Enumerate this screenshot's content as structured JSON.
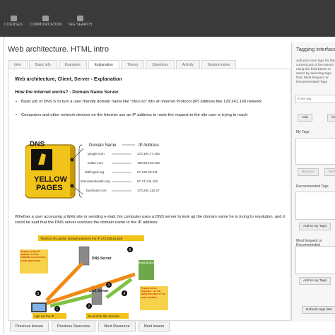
{
  "topnav": [
    {
      "label": "COURSES"
    },
    {
      "label": "COMMUNICATION"
    },
    {
      "label": "TAG SEARCH"
    }
  ],
  "page_title": "Web architecture. HTML intro",
  "tabs": [
    {
      "label": "Intro"
    },
    {
      "label": "Basic info"
    },
    {
      "label": "Examples"
    },
    {
      "label": "Explanation",
      "active": true
    },
    {
      "label": "Theory"
    },
    {
      "label": "Questions"
    },
    {
      "label": "Activity"
    },
    {
      "label": "Session notes"
    }
  ],
  "content": {
    "heading": "Web architecture, Client, Server - Explanation",
    "subheading": "How the Internet works? - Domain Name Server",
    "bullets": [
      "Basic job of DNS is to turn a user friendly domain name like \"ntnu.no\" into an Internet Protocol (IP) address like 129.241.160 network",
      "Computers and other network devices on the Internet use an IP address to route the request to the site user is trying to reach"
    ],
    "dns": {
      "logo_title": "DNS",
      "logo_line1": "YELLOW",
      "logo_line2": "PAGES",
      "col_domain": "Domain Name",
      "col_ip": "IP Address",
      "rows": [
        {
          "domain": "google.com",
          "ip": "173.194.77.184"
        },
        {
          "domain": "twitter.com",
          "ip": "199.59.149.230"
        },
        {
          "domain": "allthingsd.org",
          "ip": "67.132.20.211"
        },
        {
          "domain": "ibmnetworkradio.org",
          "ip": "97.74.144.182"
        },
        {
          "domain": "facebook.com",
          "ip": "173.252.110.27"
        }
      ]
    },
    "paragraph": "Whether a user accessing a Web site or sending e-mail, his computer uses a DNS server to look up the domain name he is trying to resolution, and it could be said that the DNS server resolves the domain name to the IP address.",
    "diagram": {
      "banner": "That's in my cache. Domain points to the IP 173.245.61.526",
      "server_top": "DNS Server",
      "server_bottom": "DNS Server",
      "site": "www.gohacking.com",
      "note_left": "Thanks for the IP address. Let me establish a connection to the server now.",
      "note_right": "Thanks for the response. Let me cache the same IP for some duration",
      "bottom_left": "I get me the IP",
      "bottom_mid": "Record for this Domain",
      "nums": [
        "1",
        "2",
        "3",
        "4",
        "5",
        "6"
      ]
    }
  },
  "pager": [
    {
      "label": "Previous lesson"
    },
    {
      "label": "Previous Resource"
    },
    {
      "label": "Next Resource"
    },
    {
      "label": "Next lesson"
    }
  ],
  "panel": {
    "title": "Tagging interface",
    "description": "Add your own tags for the current part of the lesson using the field below or select by selecting tags from Most frequent or Recommended Tags",
    "input_placeholder": "Enter tag",
    "add_label": "Add",
    "clear_label": "Clear",
    "my_tags_label": "My Tags",
    "remove_label": "Remove",
    "remove_all_label": "Remove all",
    "recommended_label": "Recommended Tags",
    "add_to_my_tags": "Add to my Tags",
    "most_frequent_label": "Most frequent or Recommended",
    "add_to_my_tags2": "Add to my Tags",
    "refresh_label": "Refresh tags lists"
  },
  "colors": {
    "topbar": "#3a3a3a",
    "yellow": "#f2c318",
    "arrow_orange": "#f08a12",
    "arrow_green": "#7ec144"
  }
}
